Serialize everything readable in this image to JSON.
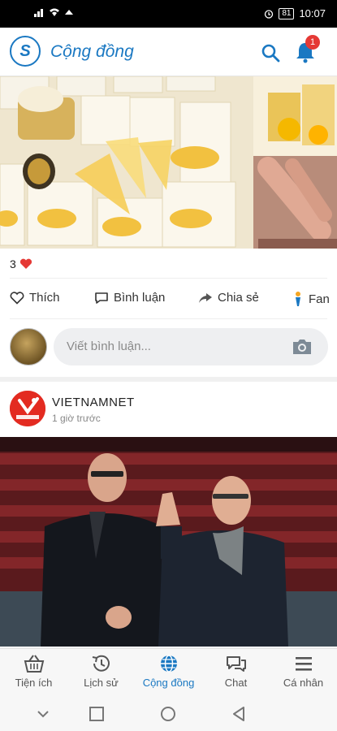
{
  "status_bar": {
    "time": "10:07",
    "battery": "81"
  },
  "app_bar": {
    "title": "Cộng đồng",
    "notification_count": "1"
  },
  "post": {
    "like_count": "3",
    "actions": [
      {
        "label": "Thích",
        "icon": "heart-outline-icon"
      },
      {
        "label": "Bình luận",
        "icon": "comment-icon"
      },
      {
        "label": "Chia sẻ",
        "icon": "share-icon"
      },
      {
        "label": "Fan",
        "icon": "fan-icon"
      }
    ],
    "comment_placeholder": "Viết bình luận..."
  },
  "next_post": {
    "source_name": "VIETNAMNET",
    "time_ago": "1 giờ trước"
  },
  "tabs": [
    {
      "label": "Tiện ích",
      "icon": "basket-icon"
    },
    {
      "label": "Lịch sử",
      "icon": "history-icon"
    },
    {
      "label": "Cộng đồng",
      "icon": "globe-icon",
      "active": true
    },
    {
      "label": "Chat",
      "icon": "chat-icon"
    },
    {
      "label": "Cá nhân",
      "icon": "menu-icon"
    }
  ],
  "colors": {
    "accent": "#1a78c2",
    "like": "#e53935",
    "source_brand": "#e32b21"
  }
}
